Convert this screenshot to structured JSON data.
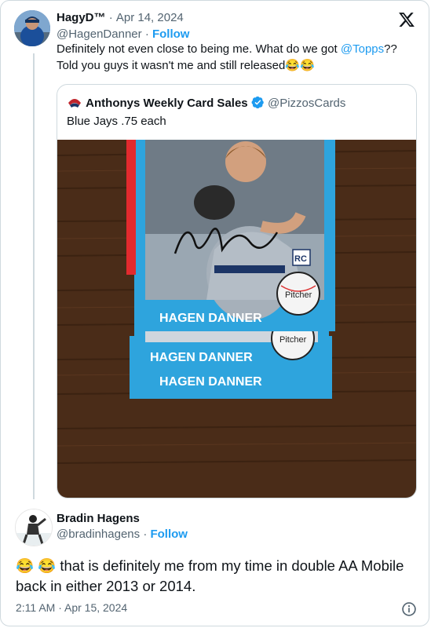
{
  "tweet": {
    "display_name": "HagyD™",
    "date_sep": "·",
    "date": "Apr 14, 2024",
    "handle": "@HagenDanner",
    "follow_sep": "·",
    "follow_label": "Follow",
    "text_part1": "Definitely not even close to being me. What do we got ",
    "mention": "@Topps",
    "text_part2": "?? Told you guys it wasn't me and still released😂😂"
  },
  "quote": {
    "display_name": "Anthonys Weekly Card Sales",
    "handle": "@PizzosCards",
    "text": "Blue Jays .75 each",
    "photo": {
      "card_name": "HAGEN DANNER",
      "position_label": "Pitcher",
      "rookie_label": "RC"
    }
  },
  "reply": {
    "display_name": "Bradin Hagens",
    "handle": "@bradinhagens",
    "follow_sep": "·",
    "follow_label": "Follow",
    "text": "😂 😂 that is definitely me from my time in double AA Mobile back in either 2013 or 2014.",
    "time": "2:11 AM · Apr 15, 2024"
  },
  "icons": {
    "x_logo": "x-logo-icon",
    "verified": "verified-badge-icon",
    "info": "info-icon"
  },
  "colors": {
    "link": "#1d9bf0",
    "muted": "#536471",
    "text": "#0f1419",
    "card_blue": "#2ea4dd",
    "card_red": "#e22a2e"
  }
}
